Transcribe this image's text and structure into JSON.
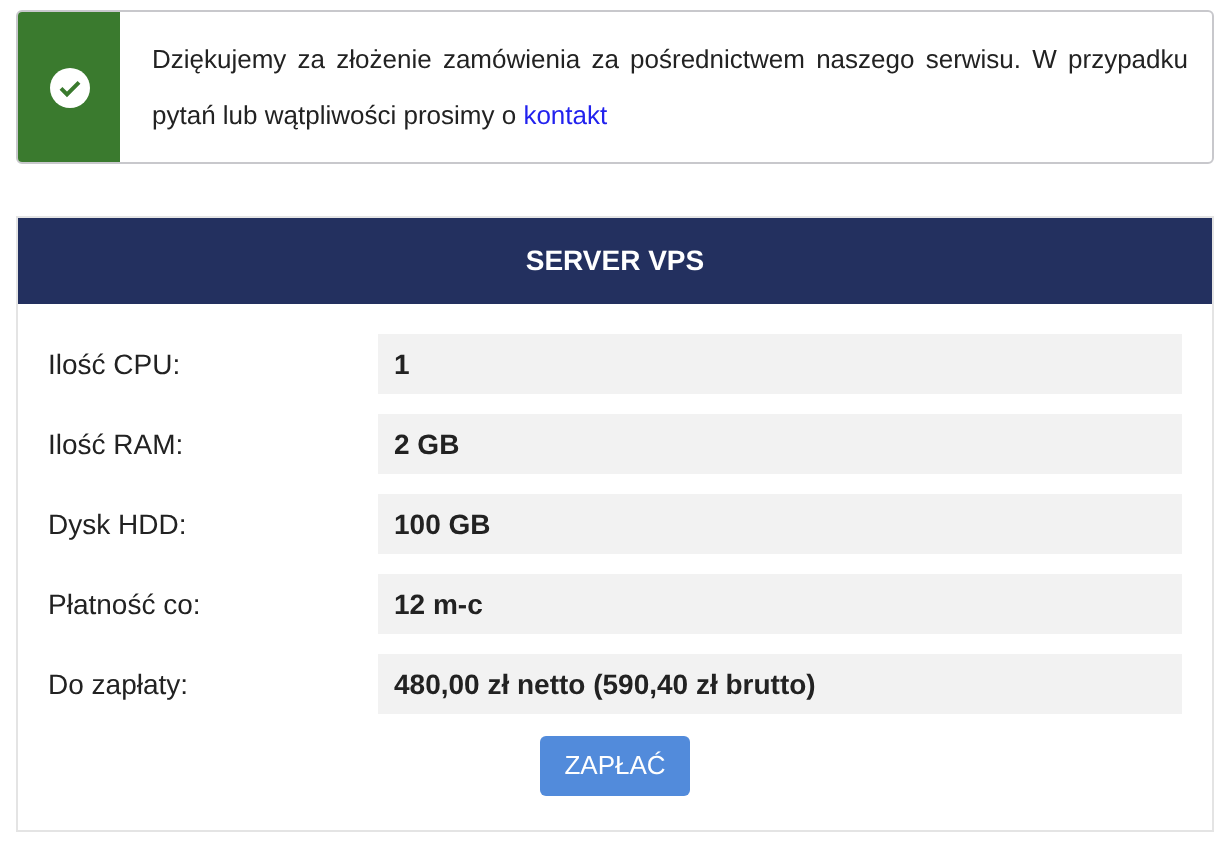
{
  "alert": {
    "message": "Dziękujemy za złożenie zamówienia za pośrednictwem naszego serwisu. W przypadku pytań lub wątpliwości prosimy o",
    "link": "kontakt"
  },
  "card": {
    "title": "SERVER VPS",
    "rows": [
      {
        "label": "Ilość CPU:",
        "value": "1"
      },
      {
        "label": "Ilość RAM:",
        "value": "2 GB"
      },
      {
        "label": "Dysk HDD:",
        "value": "100 GB"
      },
      {
        "label": "Płatność co:",
        "value": "12 m-c"
      },
      {
        "label": "Do zapłaty:",
        "value": "480,00 zł netto (590,40 zł brutto)"
      }
    ],
    "button": "ZAPŁAĆ"
  }
}
